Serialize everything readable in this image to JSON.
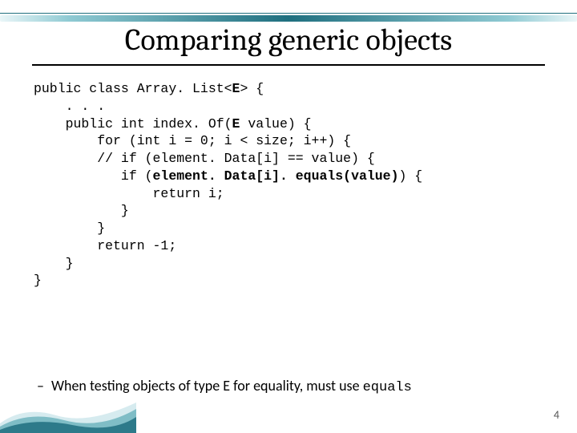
{
  "title": "Comparing generic objects",
  "code": {
    "l1a": "public class Array. List<",
    "l1b": "E",
    "l1c": "> {",
    "l2": "    . . .",
    "l3a": "    public int index. Of(",
    "l3b": "E",
    "l3c": " value) {",
    "l4": "        for (int i = 0; i < size; i++) {",
    "l5": "        // if (element. Data[i] == value) {",
    "l6a": "           if (",
    "l6b": "element. Data[i]. equals(value)",
    "l6c": ") {",
    "l7": "               return i;",
    "l8": "           }",
    "l9": "        }",
    "l10": "        return -1;",
    "l11": "    }",
    "l12": "}"
  },
  "bullet": {
    "dash": "–",
    "text": "When testing objects of type E for equality, must use ",
    "mono": "equals"
  },
  "pagenum": "4"
}
